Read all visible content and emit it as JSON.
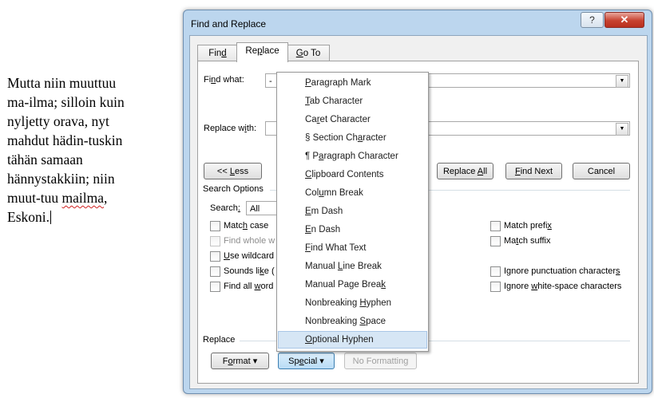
{
  "document": {
    "lines": [
      {
        "text": "Mutta niin muuttuu"
      },
      {
        "text": "ma-ilma; silloin kuin"
      },
      {
        "text": "nyljetty orava, nyt"
      },
      {
        "text": "mahdut hädin-tuskin"
      },
      {
        "text": "tähän samaan"
      },
      {
        "text": "hännystakkiin; niin"
      },
      {
        "pre": "muut-tuu ",
        "err": "mailma",
        "post": ","
      },
      {
        "text": "Eskoni."
      }
    ]
  },
  "dialog": {
    "title": "Find and Replace",
    "help_label": "?",
    "close_label": "✕",
    "tabs": [
      {
        "label": "Find",
        "accel": "d"
      },
      {
        "label": "Replace",
        "accel": "p"
      },
      {
        "label": "Go To",
        "accel": "G"
      }
    ],
    "find_label": "Find what:",
    "find_value": "-",
    "replace_label": "Replace with:",
    "replace_value": "",
    "buttons": {
      "less": "<< Less",
      "replace_all": "Replace All",
      "find_next": "Find Next",
      "cancel": "Cancel",
      "format": "Format",
      "special": "Special",
      "no_formatting": "No Formatting"
    },
    "search_options_title": "Search Options",
    "search_label": "Search:",
    "search_value": "All",
    "options_left": [
      {
        "label": "Match case",
        "enabled": true
      },
      {
        "label": "Find whole w",
        "enabled": false
      },
      {
        "label": "Use wildcard",
        "enabled": true
      },
      {
        "label": "Sounds like (",
        "enabled": true
      },
      {
        "label": "Find all word",
        "enabled": true
      }
    ],
    "options_right": [
      {
        "label": "Match prefix"
      },
      {
        "label": "Match suffix"
      },
      {
        "label": "Ignore punctuation characters"
      },
      {
        "label": "Ignore white-space characters"
      }
    ],
    "replace_section_title": "Replace"
  },
  "special_menu": {
    "items": [
      "Paragraph Mark",
      "Tab Character",
      "Caret Character",
      "§ Section Character",
      "¶ Paragraph Character",
      "Clipboard Contents",
      "Column Break",
      "Em Dash",
      "En Dash",
      "Find What Text",
      "Manual Line Break",
      "Manual Page Break",
      "Nonbreaking Hyphen",
      "Nonbreaking Space",
      "Optional Hyphen"
    ],
    "highlighted": "Optional Hyphen"
  }
}
